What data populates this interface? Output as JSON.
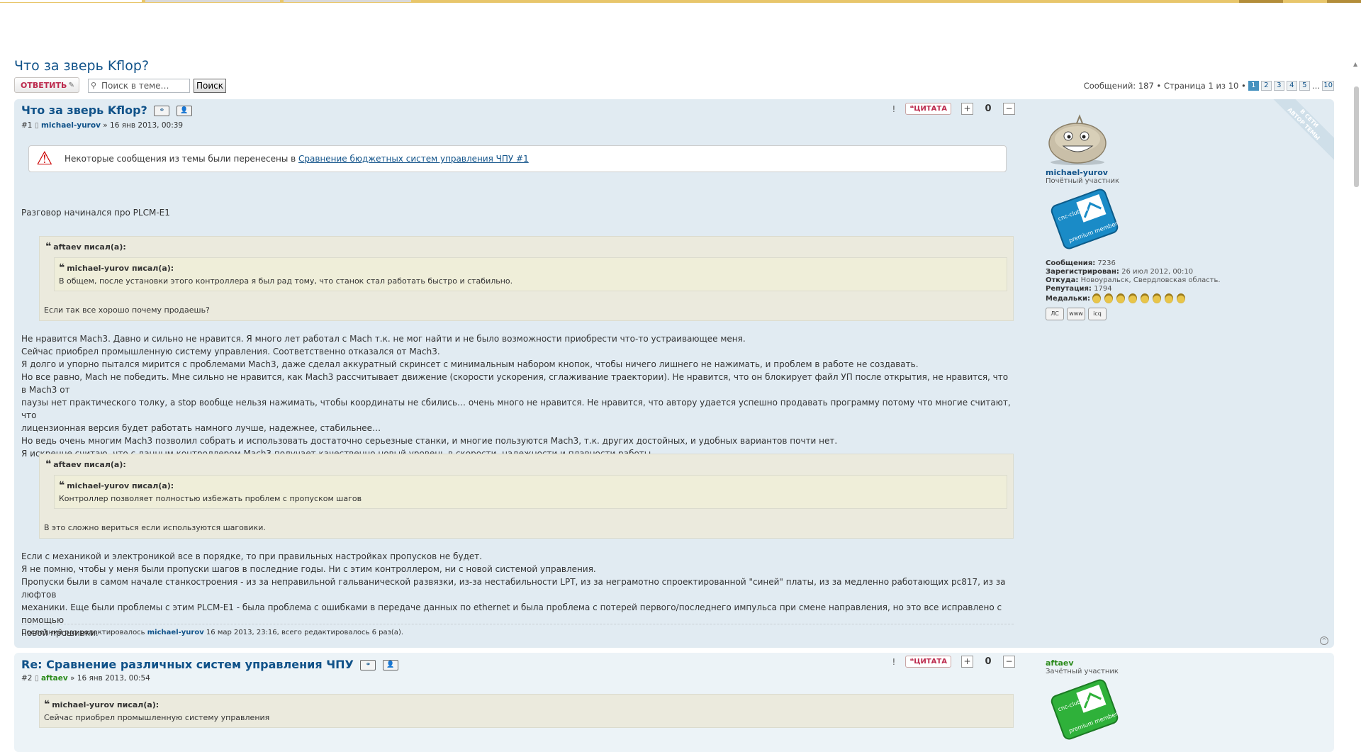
{
  "thread": {
    "title": "Что за зверь Kflop?",
    "reply_label": "ОТВЕТИТЬ",
    "search_placeholder": "Поиск в теме…",
    "search_button": "Поиск",
    "pagination": {
      "summary": "Сообщений: 187 • Страница 1 из 10 •",
      "pages": [
        "1",
        "2",
        "3",
        "4",
        "5"
      ],
      "ellipsis": "…",
      "last": "10",
      "current": "1"
    }
  },
  "actions": {
    "warn_icon": "!",
    "quote_label": "ЦИТАТА",
    "plus": "+",
    "minus": "−"
  },
  "posts": [
    {
      "title": "Что за зверь Kflop?",
      "number": "#1",
      "author": "michael-yurov",
      "date": "» 16 янв 2013, 00:39",
      "score": "0",
      "notice": {
        "text": "Некоторые сообщения из темы были перенесены в",
        "link": "Сравнение бюджетных систем управления ЧПУ #1"
      },
      "intro": "Разговор начинался про PLCM-E1",
      "quote1": {
        "cite": "aftaev писал(а):",
        "inner_cite": "michael-yurov писал(а):",
        "inner_text": "В общем, после установки этого контроллера я был рад тому, что станок стал работать быстро и стабильно.",
        "text": "Если так все хорошо почему продаешь?"
      },
      "para1": [
        "Не нравится Mach3. Давно и сильно не нравится. Я много лет работал с Mach т.к. не мог найти и не было возможности приобрести что-то устраивающее меня.",
        "Сейчас приобрел промышленную систему управления. Соответственно отказался от Mach3.",
        "Я долго и упорно пытался мирится с проблемами Mach3, даже сделал аккуратный скринсет с минимальным набором кнопок, чтобы ничего лишнего не нажимать, и проблем в работе не создавать.",
        "Но все равно, Mach не победить. Мне сильно не нравится, как Mach3 рассчитывает движение (скорости ускорения, сглаживание траектории). Не нравится, что он блокирует файл УП после открытия, не нравится, что в Mach3 от",
        "паузы нет практического толку, а stop вообще нельзя нажимать, чтобы координаты не сбились… очень много не нравится. Не нравится, что автору удается успешно продавать программу потому что многие считают, что",
        "лицензионная версия будет работать намного лучше, надежнее, стабильнее…",
        "Но ведь очень многим Mach3 позволил собрать и использовать достаточно серьезные станки, и многие пользуются Mach3, т.к. других достойных, и удобных вариантов почти нет.",
        "Я искренне считаю, что с данным контроллером Mach3 получает качественно новый уровень в скорости, надежности и плавности работы."
      ],
      "quote2": {
        "cite": "aftaev писал(а):",
        "inner_cite": "michael-yurov писал(а):",
        "inner_text": "Контроллер позволяет полностью избежать проблем с пропуском шагов",
        "text": "В это сложно вериться если используются шаговики."
      },
      "para2": [
        "Если с механикой и электроникой все в порядке, то при правильных настройках пропусков не будет.",
        "Я не помню, чтобы у меня были пропуски шагов в последние годы. Ни с этим контроллером, ни с новой системой управления.",
        "Пропуски были в самом начале станкостроения - из за неправильной гальванической развязки, из-за нестабильности LPT, из за неграмотно спроектированной \"синей\" платы, из за медленно работающих pc817, из за люфтов",
        "механики. Еще были проблемы с этим PLCM-E1 - была проблема с ошибками в передаче данных по ethernet и была проблема с потерей первого/последнего импульса при смене направления, но это все исправлено с помощью",
        "новой прошивки."
      ],
      "edit_note": {
        "prefix": "Последний раз редактировалось",
        "user": "michael-yurov",
        "suffix": "16 мар 2013, 23:16, всего редактировалось 6 раз(а)."
      },
      "ribbon": [
        "В СЕТИ",
        "АВТОР ТЕМЫ"
      ],
      "profile": {
        "name": "michael-yurov",
        "rank": "Почётный участник",
        "badge": "cnc-club.ru premium member",
        "stats": [
          {
            "label": "Сообщения:",
            "value": "7236"
          },
          {
            "label": "Зарегистрирован:",
            "value": "26 июл 2012, 00:10"
          },
          {
            "label": "Откуда:",
            "value": "Новоуральск, Свердловская область."
          },
          {
            "label": "Репутация:",
            "value": "1794"
          }
        ],
        "medals_label": "Медальки:",
        "medals_count": 8,
        "contact": [
          "ЛС",
          "www",
          "icq"
        ]
      }
    },
    {
      "title": "Re: Сравнение различных систем управления ЧПУ",
      "number": "#2",
      "author": "aftaev",
      "date": "» 16 янв 2013, 00:54",
      "score": "0",
      "quote": {
        "cite": "michael-yurov писал(а):",
        "text": "Сейчас приобрел промышленную систему управления"
      },
      "profile": {
        "name": "aftaev",
        "rank": "Зачётный участник",
        "badge": "cnc-club.ru premium member"
      }
    }
  ]
}
